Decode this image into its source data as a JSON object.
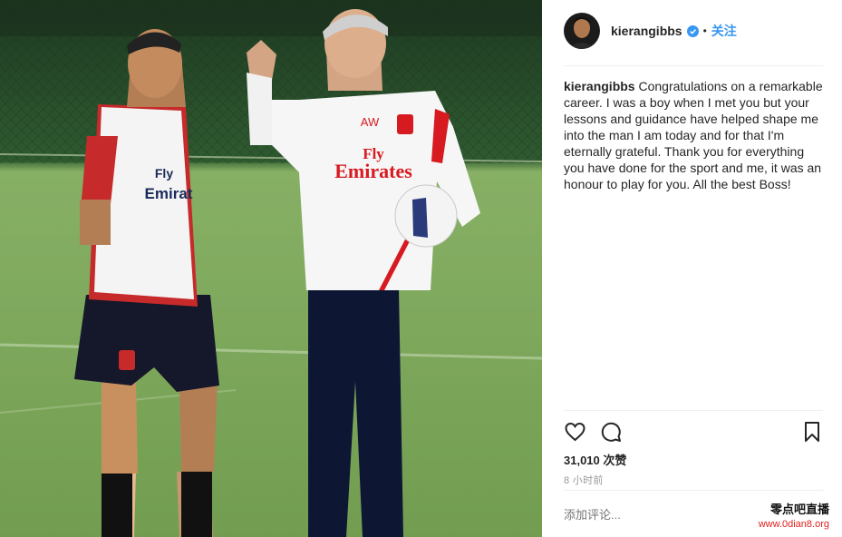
{
  "post": {
    "username": "kierangibbs",
    "verified_icon": "verified-badge-icon",
    "separator": "•",
    "follow_label": "关注",
    "caption_author": "kierangibbs",
    "caption_text": "Congratulations on a remarkable career. I was a boy when I met you but your lessons and guidance have helped shape me into the man I am today and for that I'm eternally grateful. Thank you for everything you have done for the sport and me, it was an honour to play for you. All the best Boss!",
    "likes_count": "31,010",
    "likes_label": "次赞",
    "timestamp": "8 小时前",
    "comment_placeholder": "添加评论...",
    "actions": [
      "heart-icon",
      "comment-icon",
      "bookmark-icon"
    ]
  },
  "photo": {
    "bib_text_1": "Fly",
    "bib_text_2": "Emirat",
    "shirt_initials": "AW",
    "shirt_text_1": "Fly",
    "shirt_text_2": "Emirates"
  },
  "watermark": {
    "title": "零点吧直播",
    "url": "www.0dian8.org"
  },
  "colors": {
    "follow_blue": "#3897f0",
    "verified_blue": "#3897f0",
    "arsenal_red": "#d71920",
    "watermark_red": "#e02020"
  }
}
